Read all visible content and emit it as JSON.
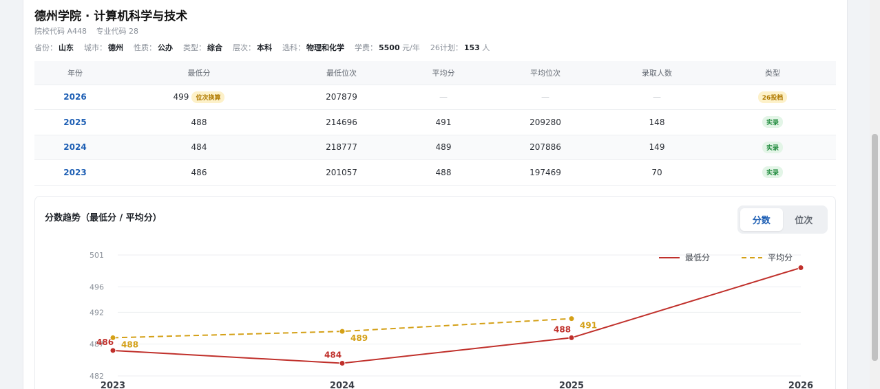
{
  "header": {
    "title": "德州学院 · 计算机科学与技术",
    "school_code": "院校代码 A448",
    "major_code": "专业代码 28"
  },
  "meta": [
    {
      "label": "省份：",
      "value": "山东"
    },
    {
      "label": "城市：",
      "value": "德州"
    },
    {
      "label": "性质：",
      "value": "公办"
    },
    {
      "label": "类型：",
      "value": "综合"
    },
    {
      "label": "层次：",
      "value": "本科"
    },
    {
      "label": "选科：",
      "value": "物理和化学"
    },
    {
      "label": "学费：",
      "value": "5500",
      "suffix": " 元/年"
    },
    {
      "label": "26计划：",
      "value": "153",
      "suffix": " 人"
    }
  ],
  "table": {
    "headers": [
      "年份",
      "最低分",
      "最低位次",
      "平均分",
      "平均位次",
      "录取人数",
      "类型"
    ],
    "rows": [
      {
        "year": "2026",
        "min_score": "499",
        "min_tag": "位次换算",
        "min_rank": "207879",
        "avg_score": "—",
        "avg_rank": "—",
        "count": "—",
        "type": "26投档",
        "type_kind": "plan"
      },
      {
        "year": "2025",
        "min_score": "488",
        "min_tag": "",
        "min_rank": "214696",
        "avg_score": "491",
        "avg_rank": "209280",
        "count": "148",
        "type": "实录",
        "type_kind": "real"
      },
      {
        "year": "2024",
        "min_score": "484",
        "min_tag": "",
        "min_rank": "218777",
        "avg_score": "489",
        "avg_rank": "207886",
        "count": "149",
        "type": "实录",
        "type_kind": "real"
      },
      {
        "year": "2023",
        "min_score": "486",
        "min_tag": "",
        "min_rank": "201057",
        "avg_score": "488",
        "avg_rank": "197469",
        "count": "70",
        "type": "实录",
        "type_kind": "real"
      }
    ]
  },
  "chart_section": {
    "title": "分数趋势（最低分 / 平均分）",
    "toggle": {
      "score": "分数",
      "rank": "位次",
      "active": "score"
    }
  },
  "chart_data": {
    "type": "line",
    "x": [
      "2023",
      "2024",
      "2025",
      "2026"
    ],
    "ylim": [
      482,
      501
    ],
    "y_ticks": [
      "482",
      "487",
      "492",
      "496",
      "501"
    ],
    "grid": true,
    "legend_position": "top-right",
    "series": [
      {
        "name": "最低分",
        "values": [
          486,
          484,
          488,
          499
        ],
        "color": "#c0302b",
        "style": "solid"
      },
      {
        "name": "平均分",
        "values": [
          488,
          489,
          491,
          null
        ],
        "color": "#d4a017",
        "style": "dashed"
      }
    ]
  }
}
